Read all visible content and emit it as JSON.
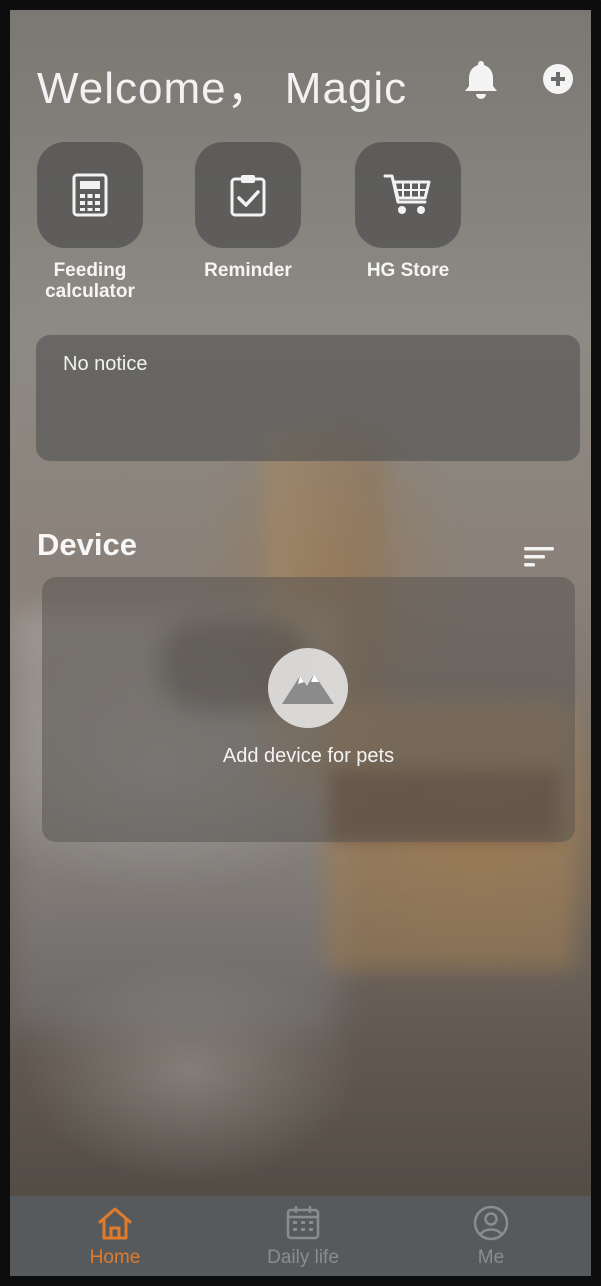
{
  "header": {
    "title": "Welcome，  Magic",
    "bell_icon": "bell-icon",
    "add_icon": "plus-circle-icon"
  },
  "quick_actions": [
    {
      "label": "Feeding\ncalculator",
      "icon": "calculator-icon"
    },
    {
      "label": "Reminder",
      "icon": "clipboard-check-icon"
    },
    {
      "label": "HG Store",
      "icon": "shopping-cart-icon"
    }
  ],
  "notice": {
    "text": "No notice"
  },
  "device": {
    "heading": "Device",
    "sort_icon": "sort-icon",
    "empty_icon": "mountain-icon",
    "empty_text": "Add device for pets"
  },
  "tabbar": {
    "tabs": [
      {
        "label": "Home",
        "icon": "home-icon",
        "active": true
      },
      {
        "label": "Daily life",
        "icon": "calendar-icon",
        "active": false
      },
      {
        "label": "Me",
        "icon": "user-icon",
        "active": false
      }
    ],
    "active_color": "#e07b2c",
    "inactive_color": "#8a8c8e"
  }
}
